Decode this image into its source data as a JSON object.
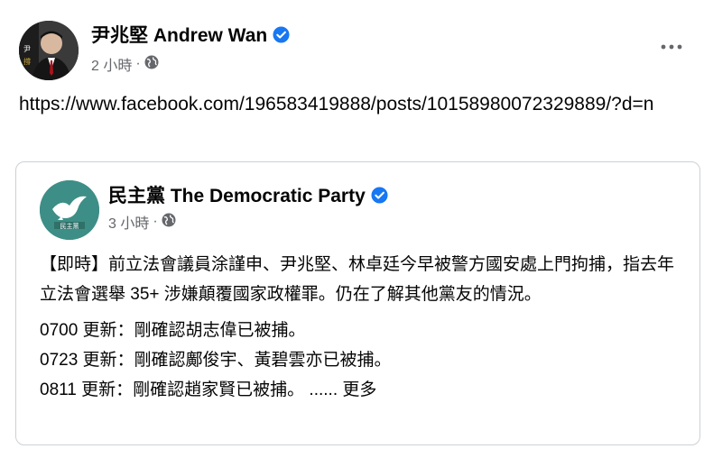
{
  "post": {
    "author": "尹兆堅 Andrew Wan",
    "time": "2 小時",
    "dot": "·",
    "audience_icon": "globe-icon",
    "more_icon": "more-options-icon",
    "text": "https://www.facebook.com/196583419888/posts/10158980072329889/?d=n"
  },
  "shared": {
    "author": "民主黨 The Democratic Party",
    "avatar_text": "民主黨",
    "time": "3 小時",
    "dot": "·",
    "body": "【即時】前立法會議員涂謹申、尹兆堅、林卓廷今早被警方國安處上門拘捕，指去年立法會選舉 35+ 涉嫌顛覆國家政權罪。仍在了解其他黨友的情況。",
    "updates": [
      "0700 更新：剛確認胡志偉已被捕。",
      "0723 更新：剛確認鄺俊宇、黃碧雲亦已被捕。",
      "0811 更新：剛確認趙家賢已被捕。"
    ],
    "ellipsis": "......",
    "see_more": "更多"
  },
  "colors": {
    "verified_blue": "#1877f2",
    "meta_gray": "#65676b",
    "border": "#ced0d4",
    "party_green": "#3d8e86"
  }
}
